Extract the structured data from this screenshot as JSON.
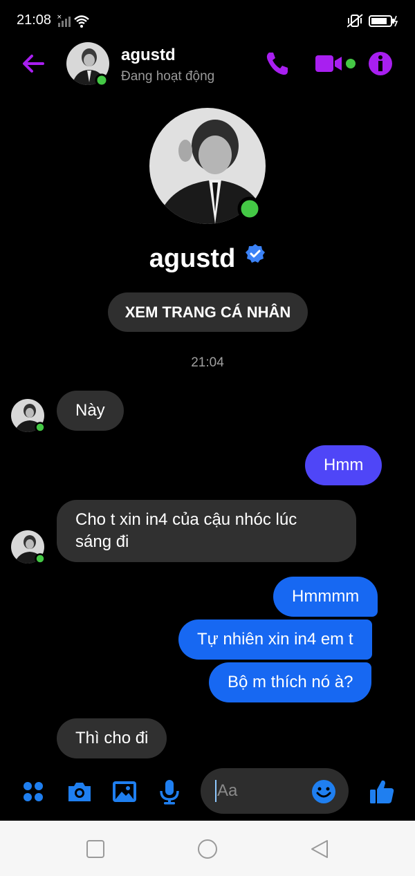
{
  "status_bar": {
    "time": "21:08",
    "left_icons": [
      "signal-icon",
      "wifi-icon"
    ],
    "right_icons": [
      "vibrate-icon",
      "battery-icon"
    ]
  },
  "header": {
    "name": "agustd",
    "status": "Đang hoạt động",
    "actions": [
      "phone-icon",
      "video-icon",
      "info-icon"
    ]
  },
  "profile": {
    "name": "agustd",
    "button_label": "XEM TRANG CÁ NHÂN"
  },
  "timestamp": "21:04",
  "messages": [
    {
      "from": "them",
      "text": "Này"
    },
    {
      "from": "me",
      "text": "Hmm"
    },
    {
      "from": "them",
      "line1": "Cho t xin in4 của cậu nhóc lúc",
      "line2": "sáng đi"
    },
    {
      "from": "me",
      "text": "Hmmmm"
    },
    {
      "from": "me",
      "text": "Tự nhiên xin in4 em t"
    },
    {
      "from": "me",
      "text": "Bộ m thích nó à?"
    },
    {
      "from": "them",
      "text": "Thì cho đi"
    }
  ],
  "composer": {
    "placeholder": "Aa",
    "buttons": [
      "apps-icon",
      "camera-icon",
      "gallery-icon",
      "mic-icon",
      "emoji-icon",
      "like-icon"
    ]
  },
  "navbar": [
    "square-icon",
    "circle-icon",
    "back-triangle-icon"
  ],
  "colors": {
    "accent_purple": "#a81ff0",
    "online_green": "#44c845",
    "bubble_in": "#303030",
    "bubble_out_purple": "#4f46f7",
    "bubble_out_blue": "#1768f2",
    "composer_blue": "#1f7ff0"
  }
}
